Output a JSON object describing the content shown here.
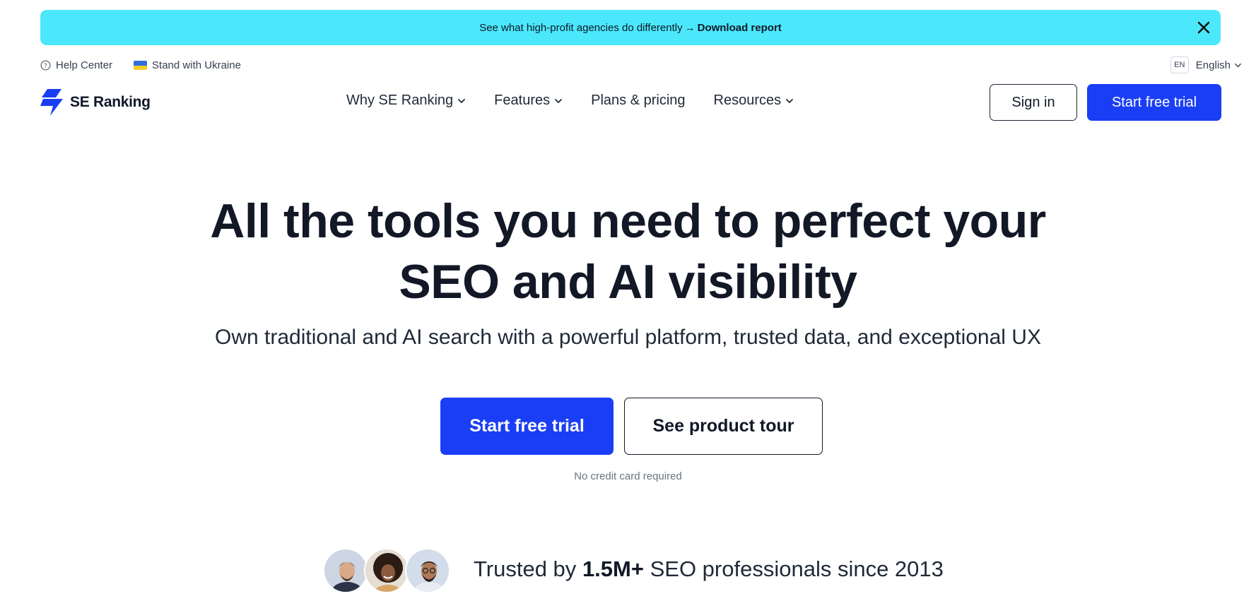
{
  "banner": {
    "text": "See what high-profit agencies do differently",
    "arrow": "→",
    "link": "Download report",
    "bg_color": "#4be8fb",
    "close_icon": "close-icon"
  },
  "utility": {
    "help_center": "Help Center",
    "ukraine": "Stand with Ukraine",
    "lang_code": "EN",
    "lang_name": "English"
  },
  "nav": {
    "logo_text": "SE Ranking",
    "items": [
      {
        "label": "Why SE Ranking",
        "has_dropdown": true
      },
      {
        "label": "Features",
        "has_dropdown": true
      },
      {
        "label": "Plans & pricing",
        "has_dropdown": false
      },
      {
        "label": "Resources",
        "has_dropdown": true
      }
    ],
    "sign_in": "Sign in",
    "start_trial": "Start free trial",
    "accent_color": "#1a3ef5"
  },
  "hero": {
    "title_line1": "All the tools you need to perfect your",
    "title_line2": "SEO and AI visibility",
    "subtitle": "Own traditional and AI search with a powerful platform, trusted data, and exceptional UX",
    "primary_cta": "Start free trial",
    "secondary_cta": "See product tour",
    "note": "No credit card required"
  },
  "trusted": {
    "prefix": "Trusted by",
    "count": "1.5M+",
    "suffix": "SEO professionals since 2013"
  }
}
